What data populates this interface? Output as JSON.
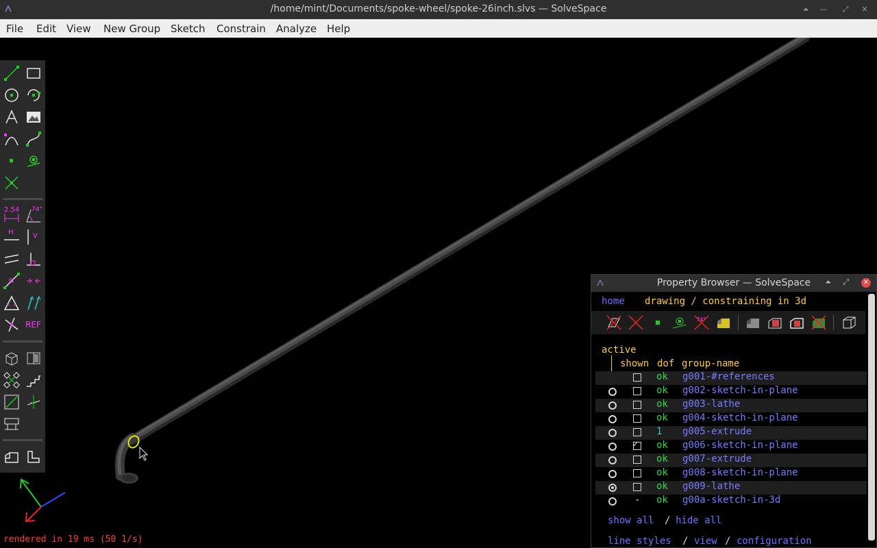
{
  "window": {
    "title": "/home/mint/Documents/spoke-wheel/spoke-26inch.slvs — SolveSpace"
  },
  "menu": {
    "items": [
      "File",
      "Edit",
      "View",
      "New Group",
      "Sketch",
      "Constrain",
      "Analyze",
      "Help"
    ]
  },
  "toolbar": {
    "tools": [
      "line-icon",
      "rectangle-icon",
      "circle-icon",
      "arc-icon",
      "text-icon",
      "image-icon",
      "tangent-arc-icon",
      "spline-icon",
      "point-icon",
      "workplane-icon",
      "split-curves-icon",
      "distance-constraint-icon",
      "angle-constraint-icon",
      "horizontal-icon",
      "vertical-icon",
      "parallel-icon",
      "perpendicular-icon",
      "point-on-line-icon",
      "symmetric-icon",
      "equal-icon",
      "same-orientation-icon",
      "other-supplementary-icon",
      "reference-icon",
      "nearest-iso-icon",
      "nearest-ortho-icon",
      "step-translate-icon",
      "step-rotate-icon",
      "sketch-in-3d-icon",
      "sketch-in-plane-icon",
      "tangent-icon",
      "extrude-icon"
    ],
    "labels": {
      "distance": "2.54",
      "angle": "74°",
      "horizontal": "H",
      "vertical": "V",
      "reference": "REF"
    }
  },
  "status": {
    "text": "rendered in 19 ms (50 1/s)"
  },
  "property_browser": {
    "title": "Property Browser — SolveSpace",
    "nav_home": "home",
    "mode_text": "drawing / constraining in 3d",
    "active_label": "active",
    "col_shown": "shown",
    "col_dof": "dof",
    "col_name": "group-name",
    "groups": [
      {
        "name": "g001-#references",
        "dof": "ok",
        "shown": false,
        "active": null
      },
      {
        "name": "g002-sketch-in-plane",
        "dof": "ok",
        "shown": false,
        "active": false
      },
      {
        "name": "g003-lathe",
        "dof": "ok",
        "shown": false,
        "active": false
      },
      {
        "name": "g004-sketch-in-plane",
        "dof": "ok",
        "shown": false,
        "active": false
      },
      {
        "name": "g005-extrude",
        "dof": "1",
        "shown": false,
        "active": false
      },
      {
        "name": "g006-sketch-in-plane",
        "dof": "ok",
        "shown": true,
        "active": false
      },
      {
        "name": "g007-extrude",
        "dof": "ok",
        "shown": false,
        "active": false
      },
      {
        "name": "g008-sketch-in-plane",
        "dof": "ok",
        "shown": false,
        "active": false
      },
      {
        "name": "g009-lathe",
        "dof": "ok",
        "shown": false,
        "active": true
      },
      {
        "name": "g00a-sketch-in-3d",
        "dof": "ok",
        "shown": "-",
        "active": false
      }
    ],
    "show_all": "show all",
    "slash1": "/",
    "hide_all": "hide all",
    "line_styles": "line styles",
    "slash2": "/",
    "view": "view",
    "slash3": "/",
    "configuration": "configuration"
  }
}
